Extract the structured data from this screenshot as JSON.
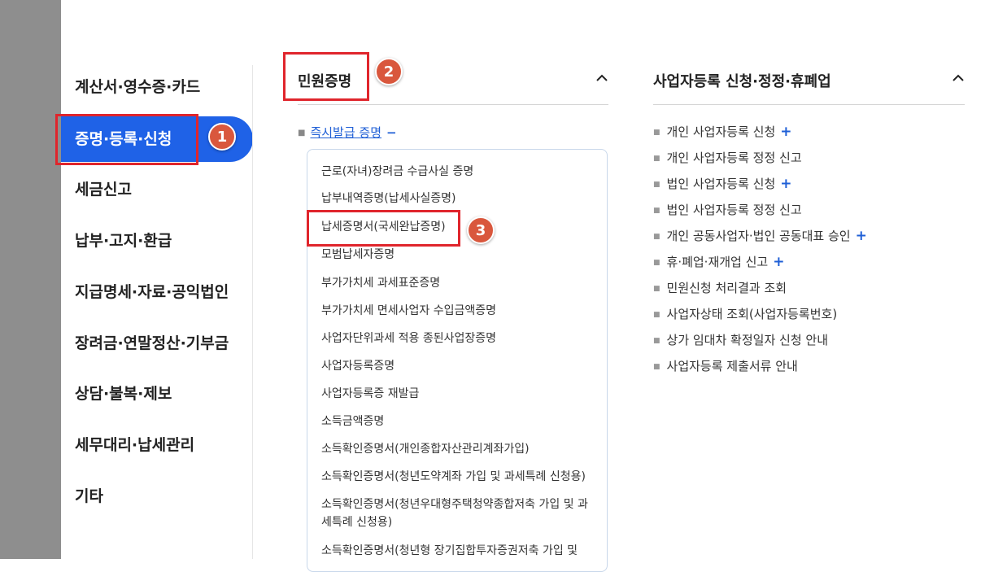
{
  "sidebar": {
    "items": [
      {
        "label": "계산서·영수증·카드"
      },
      {
        "label": "증명·등록·신청"
      },
      {
        "label": "세금신고"
      },
      {
        "label": "납부·고지·환급"
      },
      {
        "label": "지급명세·자료·공익법인"
      },
      {
        "label": "장려금·연말정산·기부금"
      },
      {
        "label": "상담·불복·제보"
      },
      {
        "label": "세무대리·납세관리"
      },
      {
        "label": "기타"
      }
    ]
  },
  "badges": {
    "b1": "1",
    "b2": "2",
    "b3": "3"
  },
  "civil": {
    "title": "민원증명",
    "chevron_icon": "chevron-up-icon",
    "instant": {
      "label": "즉시발급 증명",
      "toggle": "−"
    },
    "items": [
      "근로(자녀)장려금 수급사실 증명",
      "납부내역증명(납세사실증명)",
      "납세증명서(국세완납증명)",
      "모범납세자증명",
      "부가가치세 과세표준증명",
      "부가가치세 면세사업자 수입금액증명",
      "사업자단위과세 적용 종된사업장증명",
      "사업자등록증명",
      "사업자등록증 재발급",
      "소득금액증명",
      "소득확인증명서(개인종합자산관리계좌가입)",
      "소득확인증명서(청년도약계좌 가입 및 과세특례 신청용)",
      "소득확인증명서(청년우대형주택청약종합저축 가입 및 과세특례 신청용)",
      "소득확인증명서(청년형 장기집합투자증권저축 가입 및"
    ]
  },
  "business": {
    "title": "사업자등록 신청·정정·휴폐업",
    "chevron_icon": "chevron-up-icon",
    "items": [
      {
        "label": "개인 사업자등록 신청",
        "plus": "+"
      },
      {
        "label": "개인 사업자등록 정정 신고",
        "plus": ""
      },
      {
        "label": "법인 사업자등록 신청",
        "plus": "+"
      },
      {
        "label": "법인 사업자등록 정정 신고",
        "plus": ""
      },
      {
        "label": "개인 공동사업자·법인 공동대표 승인",
        "plus": "+"
      },
      {
        "label": "휴·폐업·재개업 신고",
        "plus": "+"
      },
      {
        "label": "민원신청 처리결과 조회",
        "plus": ""
      },
      {
        "label": "사업자상태 조회(사업자등록번호)",
        "plus": ""
      },
      {
        "label": "상가 임대차 확정일자 신청 안내",
        "plus": ""
      },
      {
        "label": "사업자등록 제출서류 안내",
        "plus": ""
      }
    ]
  },
  "colors": {
    "accent": "#1f62e7",
    "highlight": "#e0252c",
    "badge": "#d9573d"
  }
}
